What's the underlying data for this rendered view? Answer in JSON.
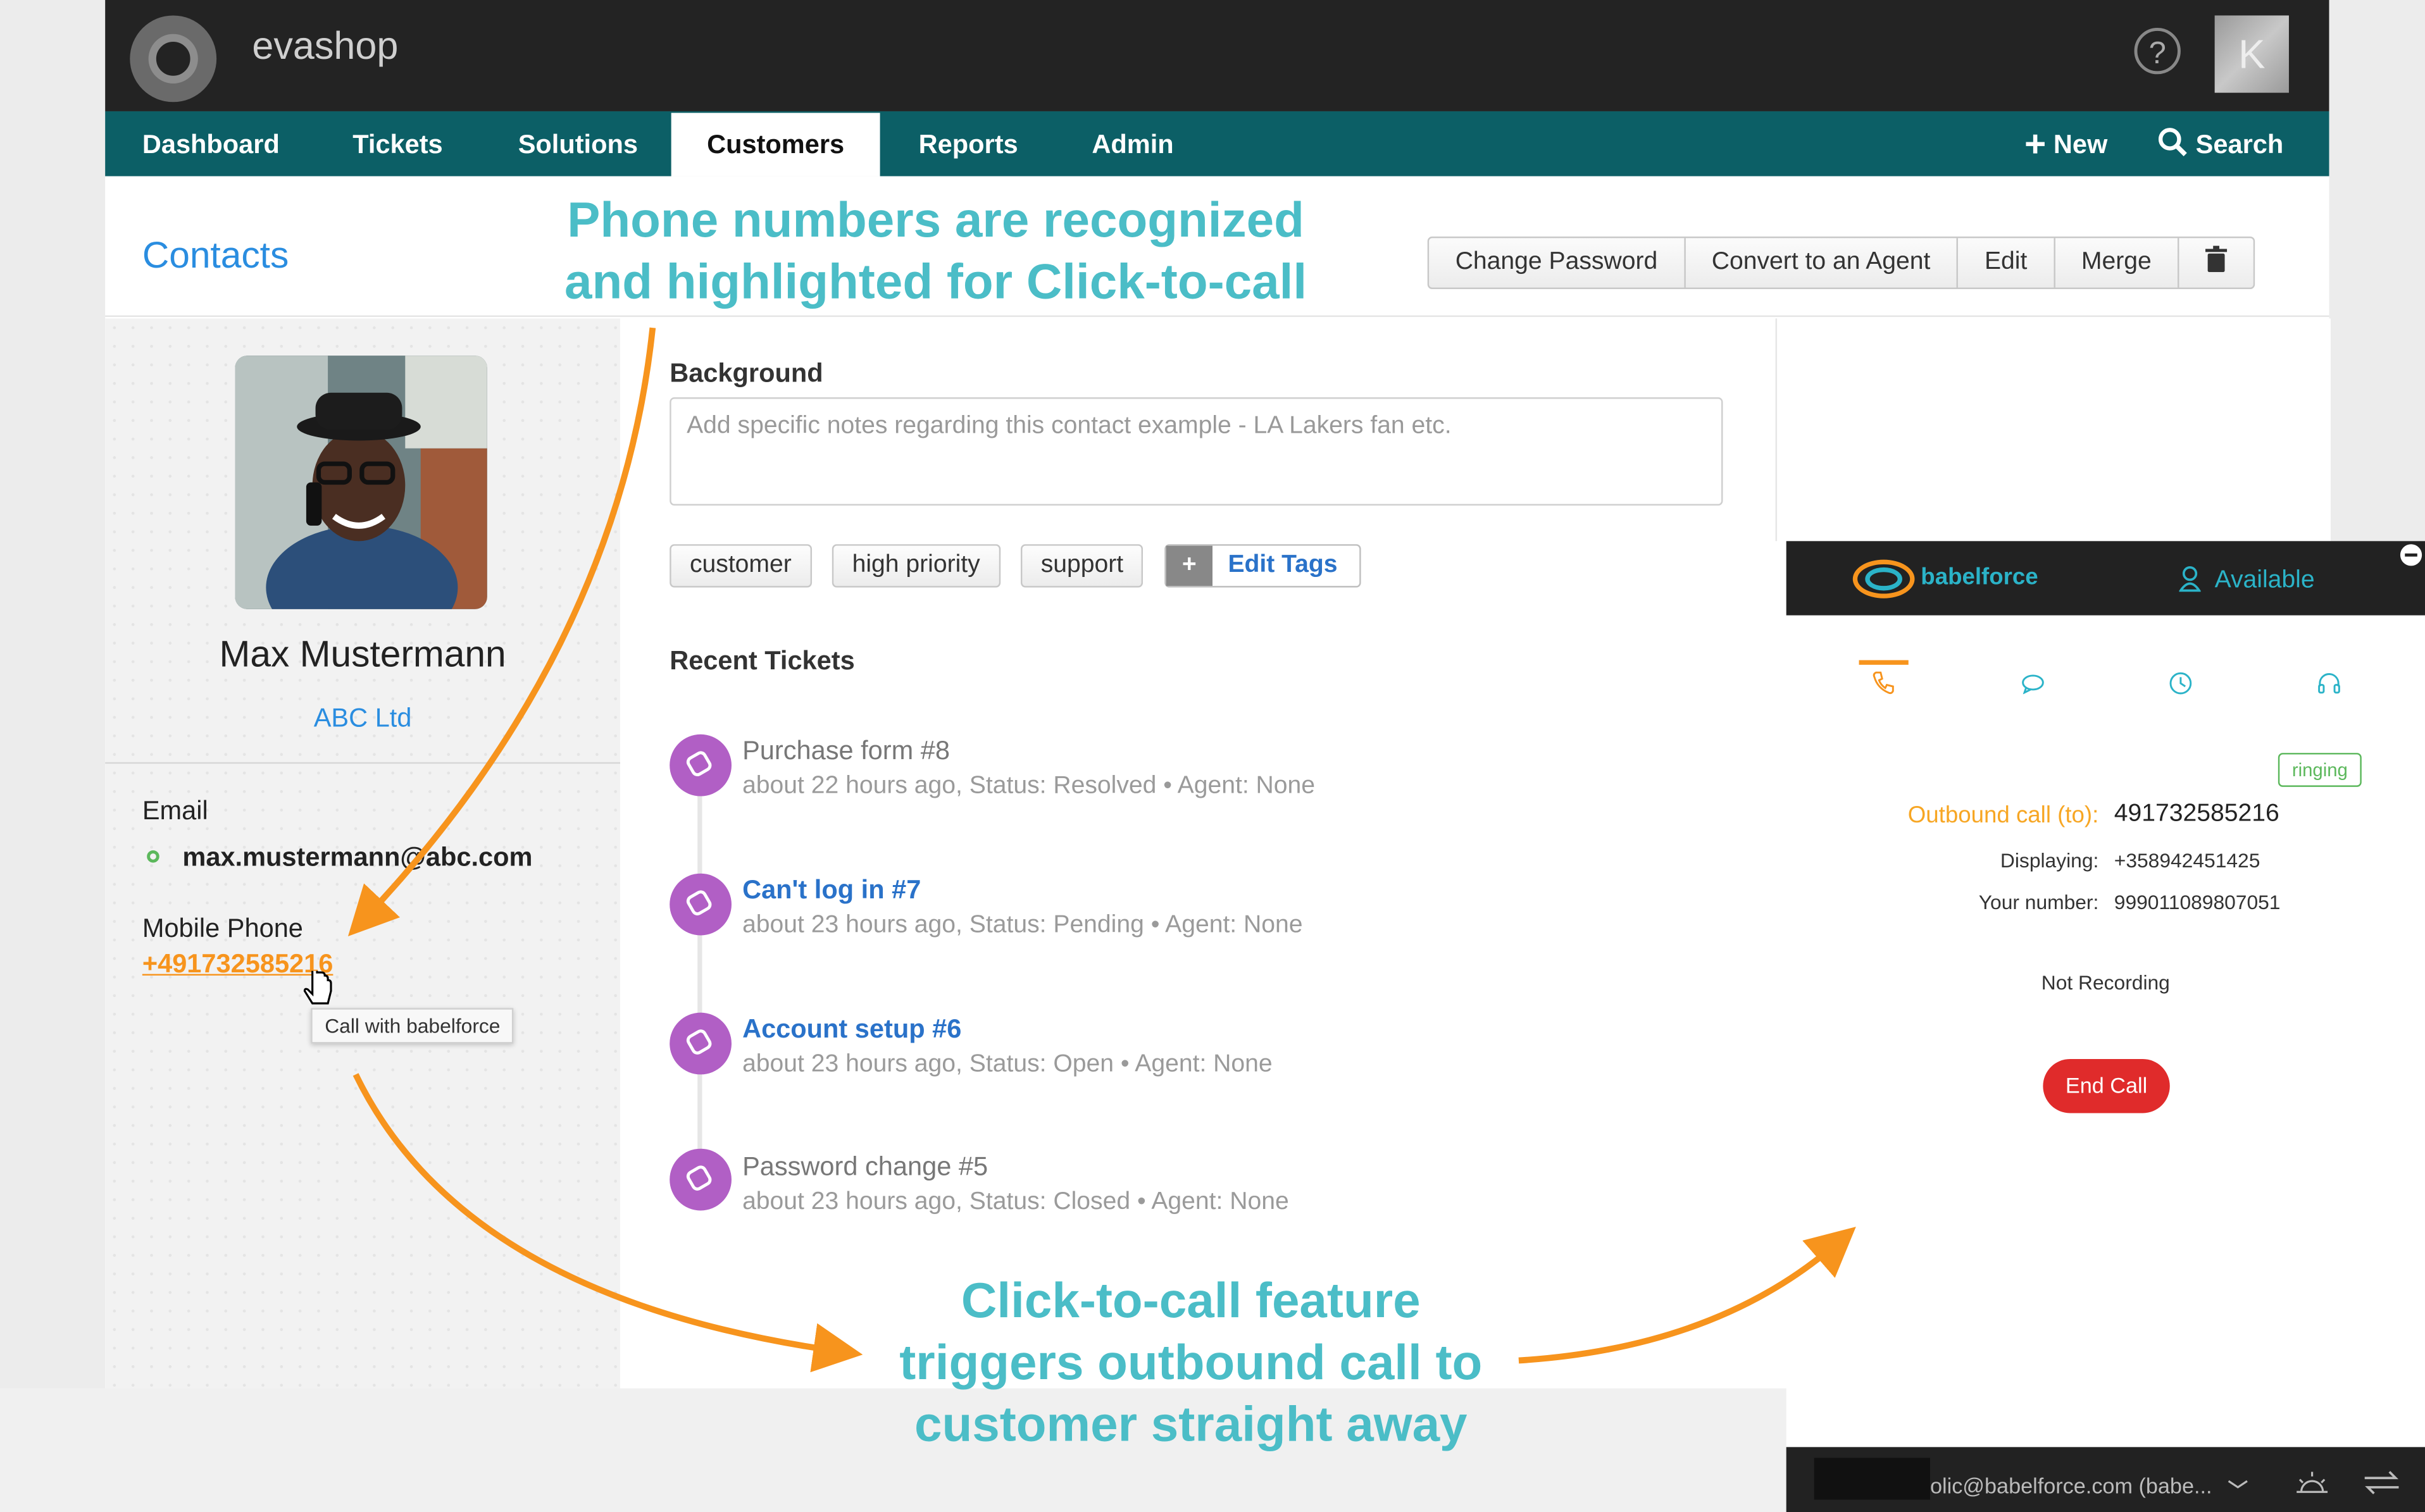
{
  "app": {
    "brand": "evashop",
    "help_icon": "?",
    "avatar_letter": "K"
  },
  "nav": {
    "items": [
      "Dashboard",
      "Tickets",
      "Solutions",
      "Customers",
      "Reports",
      "Admin"
    ],
    "active": "Customers",
    "new_label": "New",
    "search_label": "Search"
  },
  "header": {
    "breadcrumb": "Contacts",
    "actions": [
      "Change Password",
      "Convert to an Agent",
      "Edit",
      "Merge"
    ]
  },
  "callouts": {
    "top_line1": "Phone numbers are recognized",
    "top_line2": "and highlighted for Click-to-call",
    "bottom_line1": "Click-to-call feature",
    "bottom_line2": "triggers outbound call to",
    "bottom_line3": "customer straight away"
  },
  "contact": {
    "name": "Max Mustermann",
    "company": "ABC Ltd",
    "email_label": "Email",
    "email": "max.mustermann@abc.com",
    "phone_label": "Mobile Phone",
    "phone": "+491732585216",
    "tooltip": "Call with babelforce"
  },
  "background": {
    "title": "Background",
    "placeholder": "Add specific notes regarding this contact example - LA Lakers fan etc."
  },
  "tags": {
    "items": [
      "customer",
      "high priority",
      "support"
    ],
    "edit_label": "Edit Tags"
  },
  "recent_tickets": {
    "title": "Recent Tickets",
    "items": [
      {
        "title": "Purchase form #8",
        "meta": "about 22 hours ago, Status: Resolved  •  Agent: None",
        "link": false
      },
      {
        "title": "Can't log in #7",
        "meta": "about 23 hours ago, Status: Pending  •  Agent: None",
        "link": true
      },
      {
        "title": "Account setup #6",
        "meta": "about 23 hours ago, Status: Open  •  Agent: None",
        "link": true
      },
      {
        "title": "Password change #5",
        "meta": "about 23 hours ago, Status: Closed  •  Agent: None",
        "link": false
      }
    ]
  },
  "babelforce": {
    "brand": "babelforce",
    "status": "Available",
    "state_badge": "ringing",
    "outbound_label": "Outbound call (to):",
    "outbound_value": "491732585216",
    "displaying_label": "Displaying:",
    "displaying_value": "+358942451425",
    "your_number_label": "Your number:",
    "your_number_value": "999011089807051",
    "recording": "Not Recording",
    "end_call": "End Call",
    "footer_email": "olic@babelforce.com (babe..."
  },
  "colors": {
    "nav_bg": "#0c5f66",
    "topbar_bg": "#232323",
    "link_blue": "#2a8de0",
    "callout_teal": "#4bbdc7",
    "arrow_orange": "#f7941d",
    "ticket_icon_purple": "#b15fc5",
    "end_call_red": "#e02b2b"
  },
  "icons": {
    "brand_logo": "swirl-logo-icon",
    "help": "question-circle-icon",
    "new": "plus-icon",
    "search": "magnifier-icon",
    "delete": "trash-icon",
    "phone_tab": "phone-icon",
    "chat_tab": "chat-bubble-icon",
    "history_tab": "clock-icon",
    "agent_tab": "headset-icon"
  }
}
